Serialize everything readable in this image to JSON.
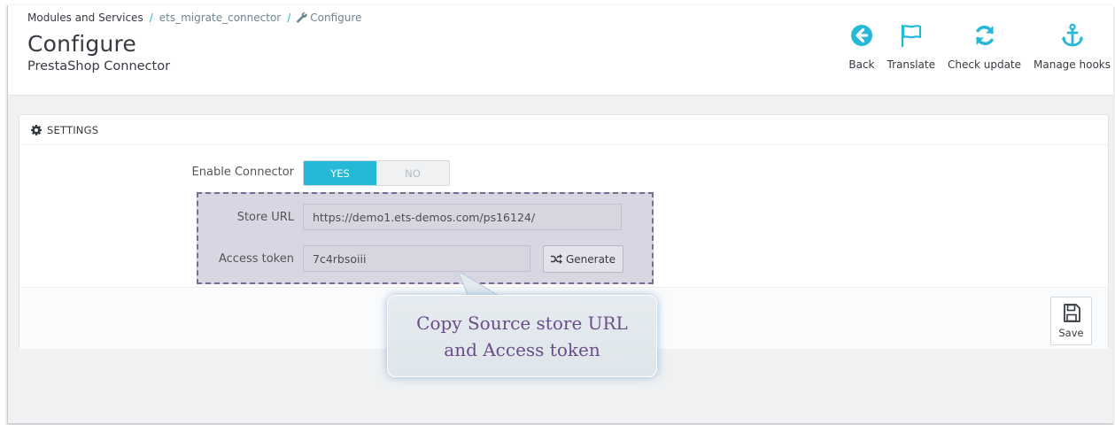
{
  "breadcrumb": {
    "items": [
      "Modules and Services",
      "ets_migrate_connector",
      "Configure"
    ],
    "separator": "/"
  },
  "page": {
    "title": "Configure",
    "subtitle": "PrestaShop Connector"
  },
  "toolbar": {
    "back": "Back",
    "translate": "Translate",
    "check_update": "Check update",
    "manage_hooks": "Manage hooks"
  },
  "panel": {
    "heading": "SETTINGS",
    "enable_connector_label": "Enable Connector",
    "toggle_yes": "YES",
    "toggle_no": "NO",
    "toggle_value": "YES",
    "store_url_label": "Store URL",
    "store_url_value": "https://demo1.ets-demos.com/ps16124/",
    "access_token_label": "Access token",
    "access_token_value": "7c4rbsoiii",
    "generate_label": "Generate",
    "save_label": "Save"
  },
  "callout": {
    "line1": "Copy Source store URL",
    "line2": "and Access token"
  },
  "colors": {
    "accent": "#25b9d7",
    "callout_text": "#6b4c8a",
    "highlight_border": "#7b6a9a"
  }
}
